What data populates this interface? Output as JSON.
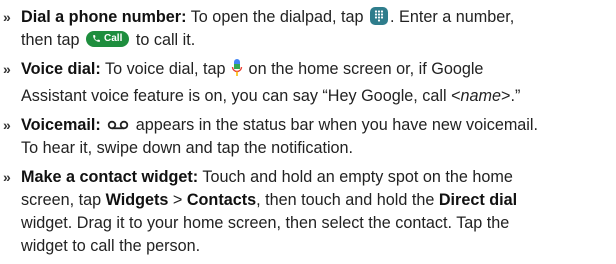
{
  "items": [
    {
      "title": "Dial a phone number:",
      "parts": {
        "a": "To open the dialpad, tap ",
        "b": ". Enter a number,",
        "c": "then tap ",
        "call_label": "Call",
        "d": " to call it."
      }
    },
    {
      "title": "Voice dial:",
      "parts": {
        "a": "To voice dial, tap ",
        "b": " on the home screen or, if Google",
        "c": "Assistant voice feature is on, you can say “Hey Google, call <",
        "name": "name",
        "d": ">.”"
      }
    },
    {
      "title": "Voicemail:",
      "parts": {
        "a": " appears in the status bar when you have new voicemail.",
        "b": "To hear it, swipe down and tap the notification."
      }
    },
    {
      "title": "Make a contact widget:",
      "parts": {
        "a": "Touch and hold an empty spot on the home",
        "b": "screen, tap ",
        "widgets": "Widgets",
        "gt": " > ",
        "contacts": "Contacts",
        "c": ", then touch and hold the ",
        "direct_dial": "Direct dial",
        "d": "widget. Drag it to your home screen, then select the contact. Tap the",
        "e": "widget to call the person."
      }
    }
  ],
  "bullet_glyph": "»",
  "icons": {
    "dialpad": "dialpad-icon",
    "call": "call-button-icon",
    "mic": "microphone-icon",
    "voicemail": "voicemail-icon"
  },
  "colors": {
    "dialpad_bg": "#2f7d8c",
    "call_bg": "#1e8e3e"
  }
}
